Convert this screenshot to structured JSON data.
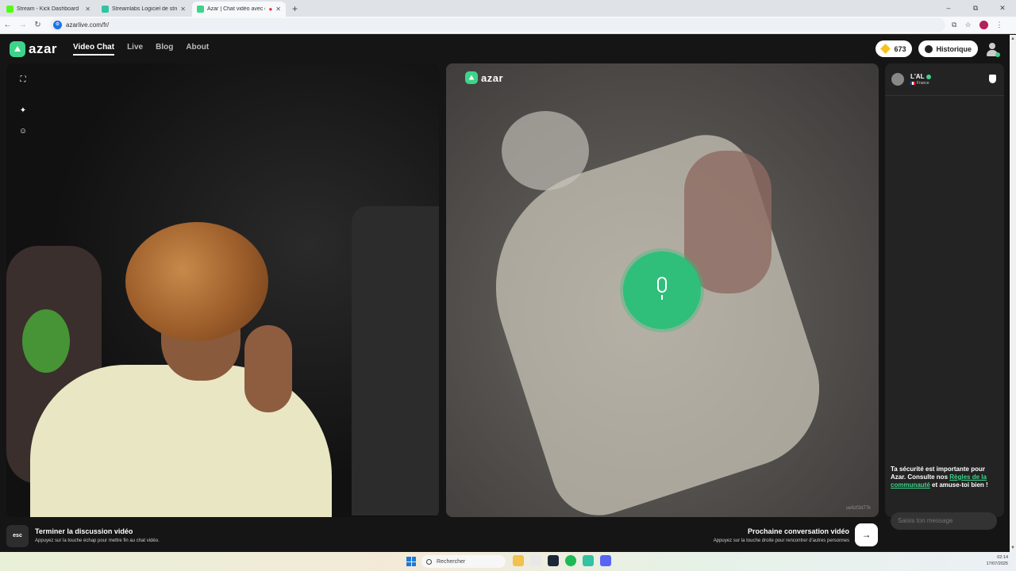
{
  "browser": {
    "tabs": [
      {
        "label": "Stream - Kick Dashboard",
        "color": "#53fc18"
      },
      {
        "label": "Streamlabs Logiciel de streaming",
        "color": "#31c3a2"
      },
      {
        "label": "Azar | Chat vidéo avec de n",
        "color": "#3ed38a"
      }
    ],
    "new_tab": "+",
    "url": "azarlive.com/fr/",
    "profile_initial": "M",
    "window_controls": [
      "–",
      "⧉",
      "✕"
    ]
  },
  "header": {
    "brand": "azar",
    "nav": [
      "Video Chat",
      "Live",
      "Blog",
      "About"
    ],
    "coins": "673",
    "history": "Historique"
  },
  "left_video": {
    "side_icons": [
      "expand-icon",
      "sparkle-icon",
      "sticker-icon"
    ]
  },
  "right_video": {
    "brand": "azar",
    "stream_id": "ue6zf3d77k",
    "mic_state": "speaking"
  },
  "chat": {
    "peer_name": "L'AL",
    "peer_country": "France",
    "notice_prefix": "Ta sécurité est importante pour Azar. Consulte nos ",
    "notice_link": "Règles de la communauté",
    "notice_suffix": " et amuse-toi bien !",
    "input_placeholder": "Saisis ton message"
  },
  "bottom": {
    "esc_key": "esc",
    "end_title": "Terminer la discussion vidéo",
    "end_sub": "Appuyez sur la touche échap pour mettre fin au chat vidéo.",
    "next_title": "Prochaine conversation vidéo",
    "next_sub": "Appuyez sur la touche droite pour rencontrer d'autres personnes",
    "next_arrow": "→"
  },
  "taskbar": {
    "search": "Rechercher",
    "time": "02:14",
    "date": "17/07/2025"
  },
  "colors": {
    "accent": "#3ed38a",
    "mic": "#2fbf7a"
  }
}
